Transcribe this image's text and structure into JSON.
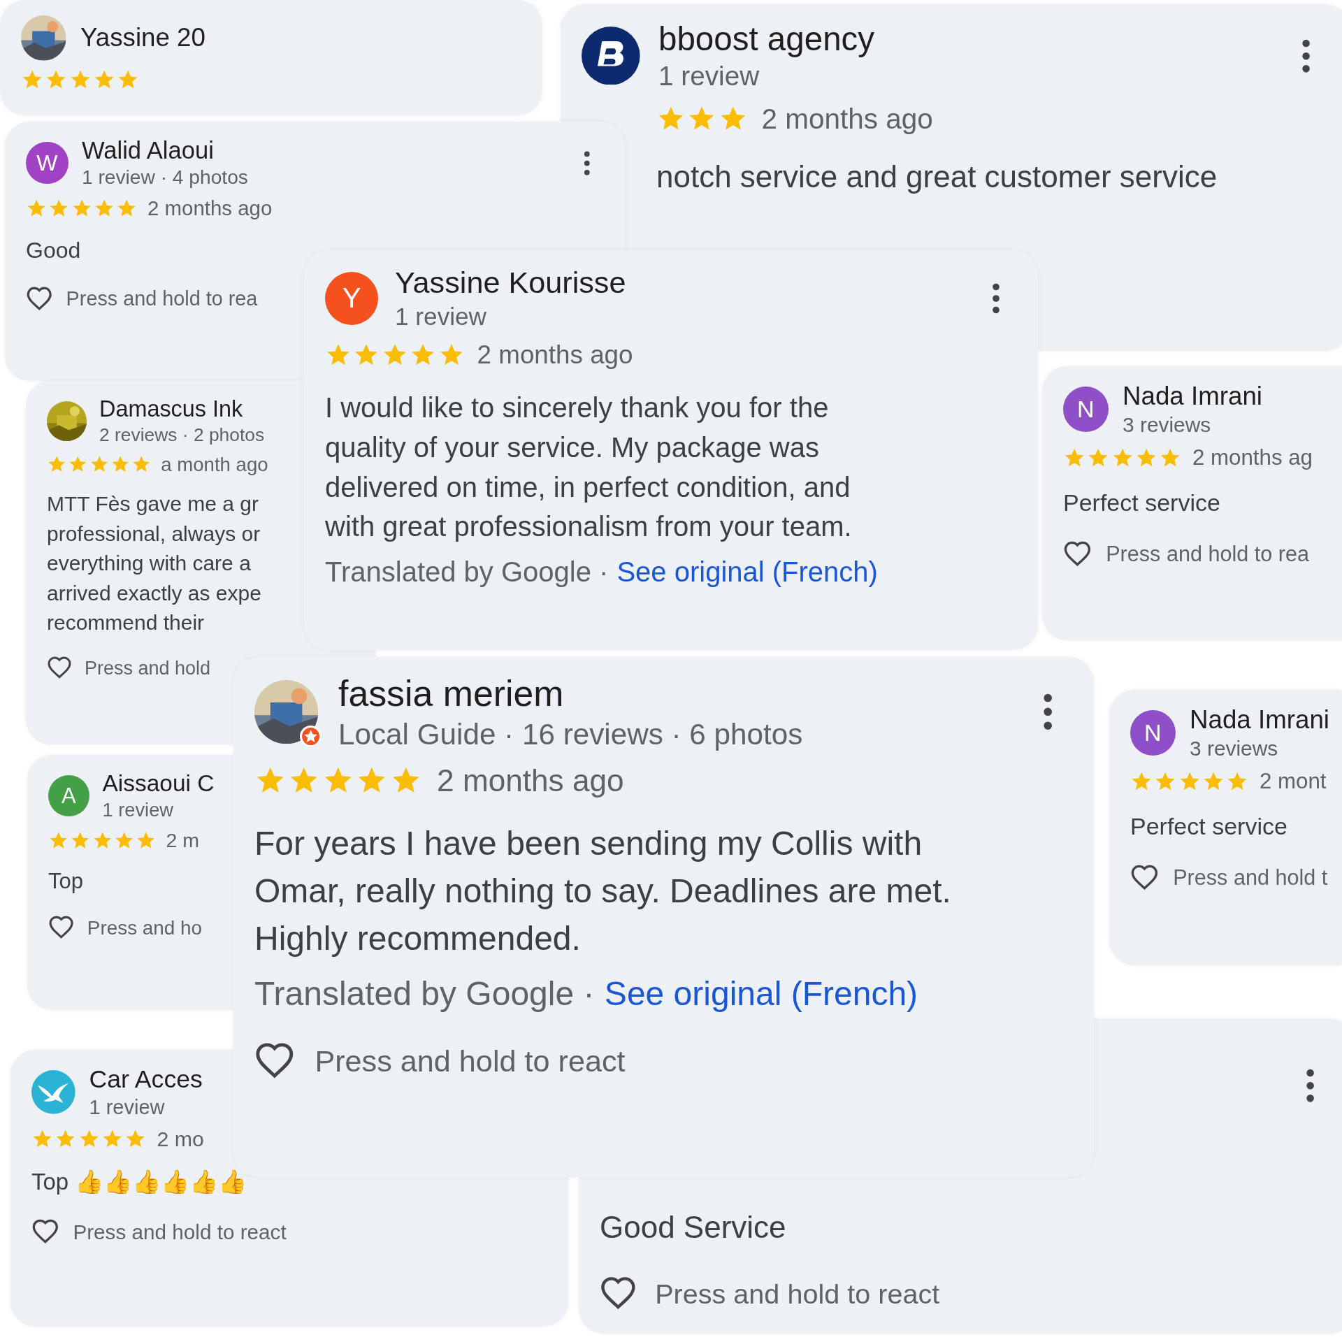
{
  "reviews": [
    {
      "avatar": {
        "kind": "picture"
      },
      "name": "Yassine 20",
      "stars": 5
    },
    {
      "avatar": {
        "kind": "logo"
      },
      "name": "bboost agency",
      "meta": "1 review",
      "stars": 3,
      "time": "2 months ago",
      "text": "notch service and great customer service",
      "menu": true
    },
    {
      "avatar": {
        "kind": "letter",
        "letter": "W",
        "color": "#a142c4"
      },
      "name": "Walid Alaoui",
      "meta": "1 review · 4 photos",
      "stars": 5,
      "time": "2 months ago",
      "text": "Good",
      "react": "Press and hold to rea",
      "menu": true
    },
    {
      "avatar": {
        "kind": "letter",
        "letter": "Y",
        "color": "#f4511e"
      },
      "name": "Yassine Kourisse",
      "meta": "1 review",
      "stars": 5,
      "time": "2 months ago",
      "text": "I would like to sincerely thank you for the\nquality of your service. My package was\ndelivered on time, in perfect condition, and\nwith great professionalism from your team.",
      "translated": {
        "note": "Translated by Google ·",
        "link": "See original (French)"
      },
      "menu": true
    },
    {
      "avatar": {
        "kind": "letter",
        "letter": "N",
        "color": "#8e4fc9"
      },
      "name": "Nada Imrani",
      "meta": "3 reviews",
      "stars": 5,
      "time": "2 months ag",
      "text": "Perfect service",
      "react": "Press and hold to rea"
    },
    {
      "avatar": {
        "kind": "picture"
      },
      "name": "Damascus Ink",
      "meta": "2 reviews · 2 photos",
      "stars": 5,
      "time": "a month ago",
      "text": "MTT Fès gave me a gr\nprofessional, always or\neverything with care a\narrived exactly as expe\nrecommend their",
      "react": "Press and hold"
    },
    {
      "avatar": {
        "kind": "picture",
        "local_guide": true
      },
      "name": "fassia meriem",
      "meta": "Local Guide · 16 reviews · 6 photos",
      "stars": 5,
      "time": "2 months ago",
      "text": "For years I have been sending my Collis with\nOmar, really nothing to say. Deadlines are met.\nHighly recommended.",
      "translated": {
        "note": "Translated by Google ·",
        "link": "See original (French)"
      },
      "react": "Press and hold to react",
      "menu": true
    },
    {
      "avatar": {
        "kind": "letter",
        "letter": "N",
        "color": "#8e4fc9"
      },
      "name": "Nada Imrani",
      "meta": "3 reviews",
      "stars": 5,
      "time": "2 mont",
      "text": "Perfect service",
      "react": "Press and hold t"
    },
    {
      "avatar": {
        "kind": "letter",
        "letter": "A",
        "color": "#43a047"
      },
      "name": "Aissaoui C",
      "meta": "1 review",
      "stars": 5,
      "time": "2 m",
      "text": "Top",
      "react": "Press and ho"
    },
    {
      "text": "Good Service",
      "react": "Press and hold to react",
      "menu": true
    },
    {
      "avatar": {
        "kind": "bird"
      },
      "name": "Car Acces",
      "meta": "1 review",
      "stars": 5,
      "time": "2 mo",
      "text": "Top 👍👍👍👍👍👍",
      "react": "Press and hold to react"
    }
  ]
}
